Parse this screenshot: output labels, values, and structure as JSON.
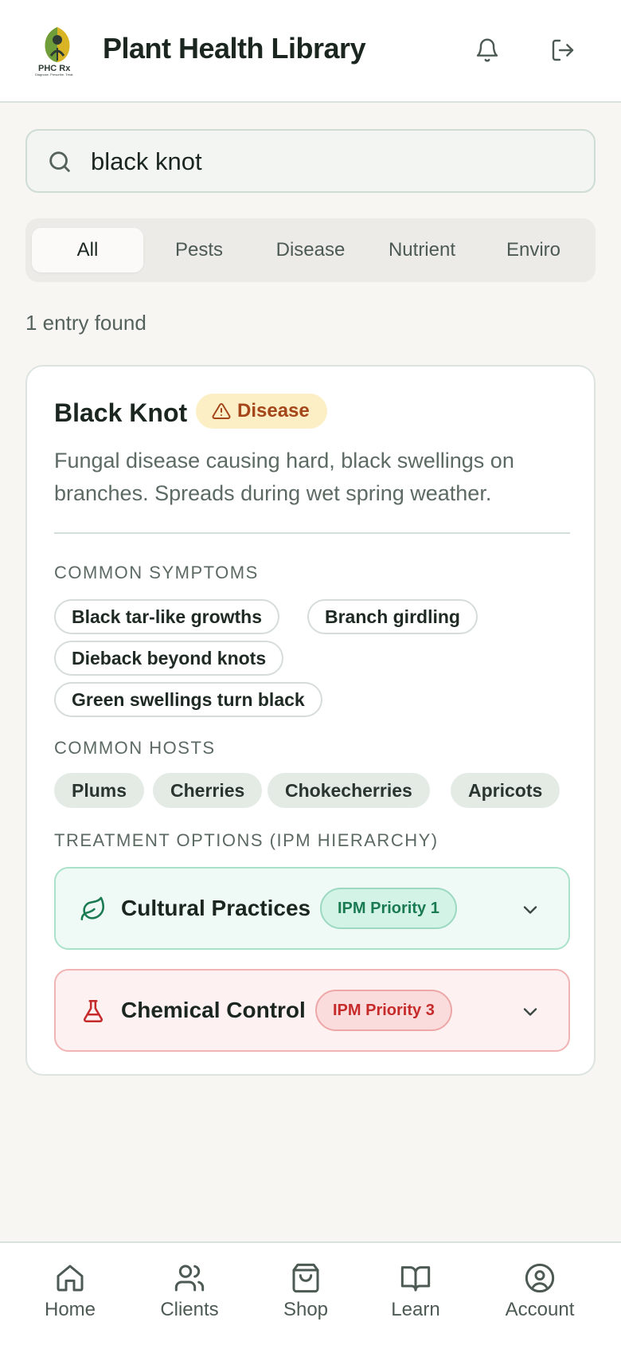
{
  "header": {
    "title": "Plant Health Library",
    "logo_text": "PHC Rx",
    "logo_tagline": "Diagnose. Prescribe. Treat.",
    "bell_icon": "bell-icon",
    "logout_icon": "logout-icon"
  },
  "search": {
    "value": "black knot",
    "icon": "search-icon"
  },
  "tabs": [
    {
      "label": "All",
      "active": true
    },
    {
      "label": "Pests",
      "active": false
    },
    {
      "label": "Disease",
      "active": false
    },
    {
      "label": "Nutrient",
      "active": false
    },
    {
      "label": "Enviro",
      "active": false
    }
  ],
  "results": {
    "count_text": "1 entry found"
  },
  "entry": {
    "title": "Black Knot",
    "category": "Disease",
    "description": "Fungal disease causing hard, black swellings on branches. Spreads during wet spring weather.",
    "symptoms_label": "COMMON SYMPTOMS",
    "symptoms": [
      "Black tar-like growths",
      "Branch girdling",
      "Dieback beyond knots",
      "Green swellings turn black"
    ],
    "hosts_label": "COMMON HOSTS",
    "hosts": [
      "Plums",
      "Cherries",
      "Chokecherries",
      "Apricots"
    ],
    "treatment_label": "TREATMENT OPTIONS (IPM HIERARCHY)",
    "treatments": [
      {
        "label": "Cultural Practices",
        "badge": "IPM Priority 1",
        "icon": "leaf-icon"
      },
      {
        "label": "Chemical Control",
        "badge": "IPM Priority 3",
        "icon": "flask-icon"
      }
    ]
  },
  "colors": {
    "accent_green": "#1a7a52",
    "disease_badge_bg": "#fcefc6",
    "disease_badge_text": "#a4461a",
    "chemical_red": "#c62b2b"
  },
  "nav": [
    {
      "label": "Home",
      "icon": "home-icon"
    },
    {
      "label": "Clients",
      "icon": "users-icon"
    },
    {
      "label": "Shop",
      "icon": "shopping-bag-icon"
    },
    {
      "label": "Learn",
      "icon": "book-icon"
    },
    {
      "label": "Account",
      "icon": "account-icon"
    }
  ]
}
